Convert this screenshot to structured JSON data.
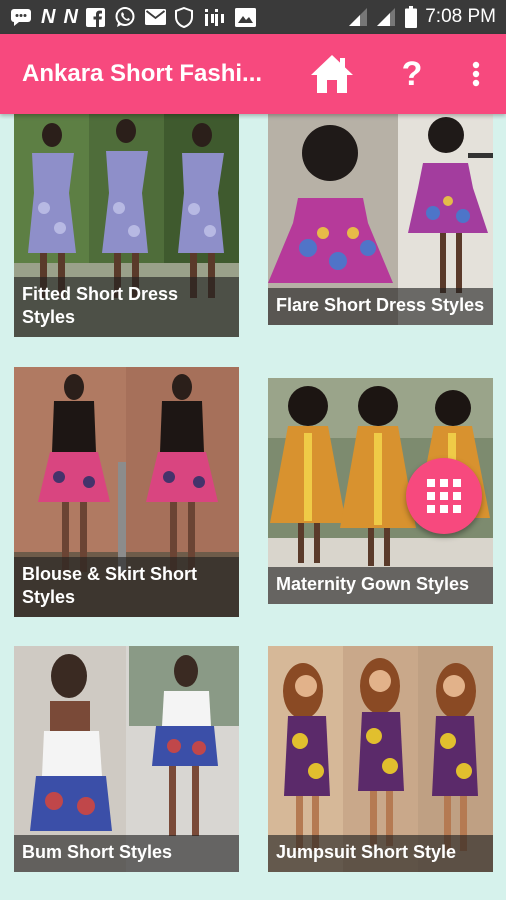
{
  "status_bar": {
    "time": "7:08 PM",
    "left_icons": [
      "message-icon",
      "n-app-icon",
      "n-app-icon",
      "facebook-icon",
      "whatsapp-icon",
      "mail-icon",
      "shield-icon",
      "jiji-icon",
      "image-icon"
    ],
    "right_icons": [
      "signal-icon",
      "signal-icon",
      "battery-icon"
    ]
  },
  "app_bar": {
    "title": "Ankara Short Fashi...",
    "home_icon": "home-icon",
    "help_label": "?",
    "more_icon": "more-vert-icon"
  },
  "cards": [
    {
      "label": "Fitted Short Dress Styles"
    },
    {
      "label": "Flare Short Dress Styles"
    },
    {
      "label": "Blouse & Skirt Short Styles"
    },
    {
      "label": "Maternity Gown Styles"
    },
    {
      "label": "Bum Short Styles"
    },
    {
      "label": "Jumpsuit Short Style"
    }
  ],
  "fab": {
    "icon": "grid-icon"
  },
  "colors": {
    "accent": "#f7497e",
    "background": "#d6f2ec",
    "status_bar": "#3a3a3a"
  }
}
